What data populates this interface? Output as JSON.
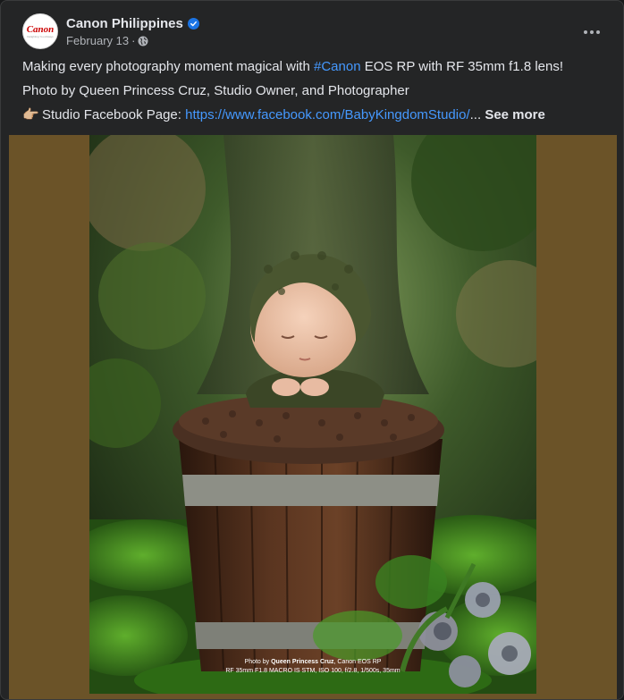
{
  "post": {
    "page_name": "Canon Philippines",
    "date": "February 13",
    "separator": "·",
    "avatar_word": "Canon",
    "avatar_tagline": "Delighting You Always",
    "verified": true,
    "privacy_icon": "globe-icon",
    "menu_icon": "more-options-icon"
  },
  "text": {
    "line1_prefix": "Making every photography moment magical with ",
    "line1_hashtag": "#Canon",
    "line1_suffix": " EOS RP with RF 35mm f1.8 lens!",
    "line2": "Photo by Queen Princess Cruz, Studio Owner, and Photographer",
    "line3_emoji": "👉🏼",
    "line3_prefix": "Studio Facebook Page: ",
    "line3_link": "https://www.facebook.com/BabyKingdomStudio/",
    "line3_ellipsis": "...",
    "see_more": "See more"
  },
  "photo": {
    "caption_prefix": "Photo by ",
    "caption_name": "Queen Princess Cruz",
    "caption_camera": ", Canon EOS RP",
    "caption_line2": "RF 35mm F1.8 MACRO IS STM, ISO 100, f/2.8, 1/500s, 35mm"
  },
  "colors": {
    "card_bg": "#242526",
    "text": "#e4e6eb",
    "muted": "#b0b3b8",
    "link": "#4599ff",
    "verified": "#1b74e4",
    "media_bg": "#6b5328"
  }
}
